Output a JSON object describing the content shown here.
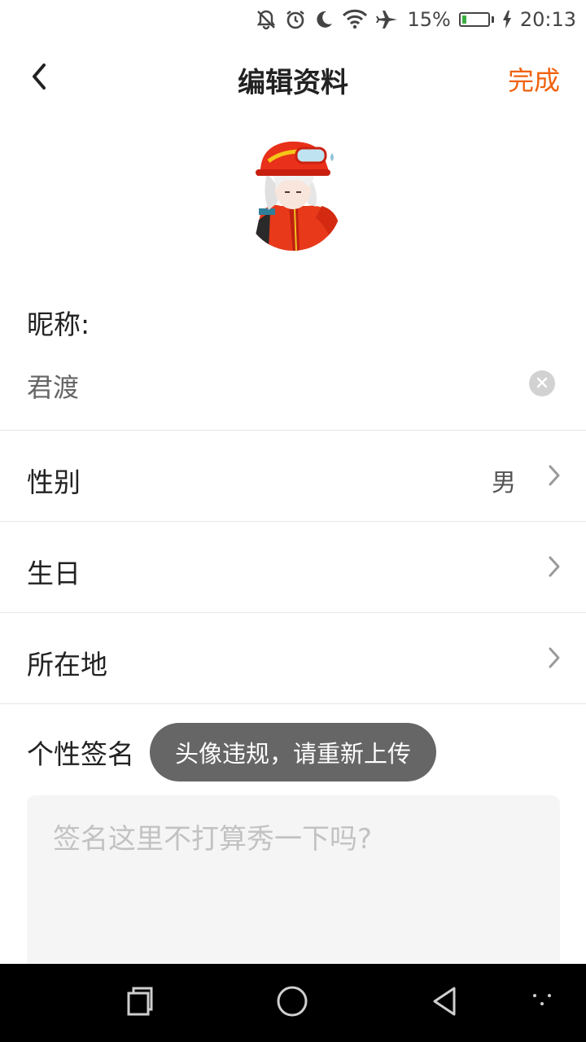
{
  "status_bar": {
    "battery_percent": "15%",
    "battery_level": 0.15,
    "time": "20:13",
    "icons": [
      "bell-off-icon",
      "alarm-icon",
      "moon-icon",
      "wifi-icon",
      "airplane-icon",
      "battery-icon",
      "charging-icon"
    ]
  },
  "header": {
    "back_icon": "chevron-left-icon",
    "title": "编辑资料",
    "done_label": "完成"
  },
  "avatar": {
    "icon": "avatar-illustration"
  },
  "nickname": {
    "label": "昵称:",
    "value": "君渡",
    "clear_icon": "clear-circle-icon"
  },
  "rows": [
    {
      "label": "性别",
      "value": "男"
    },
    {
      "label": "生日",
      "value": ""
    },
    {
      "label": "所在地",
      "value": ""
    }
  ],
  "signature": {
    "label": "个性签名",
    "placeholder": "签名这里不打算秀一下吗?"
  },
  "toast": {
    "text": "头像违规，请重新上传"
  },
  "nav_bar": {
    "icons": [
      "recents-icon",
      "home-icon",
      "back-triangle-icon",
      "more-dots-icon"
    ]
  },
  "colors": {
    "accent": "#f0620f",
    "toast_bg": "#666666",
    "nav_bg": "#000000"
  }
}
